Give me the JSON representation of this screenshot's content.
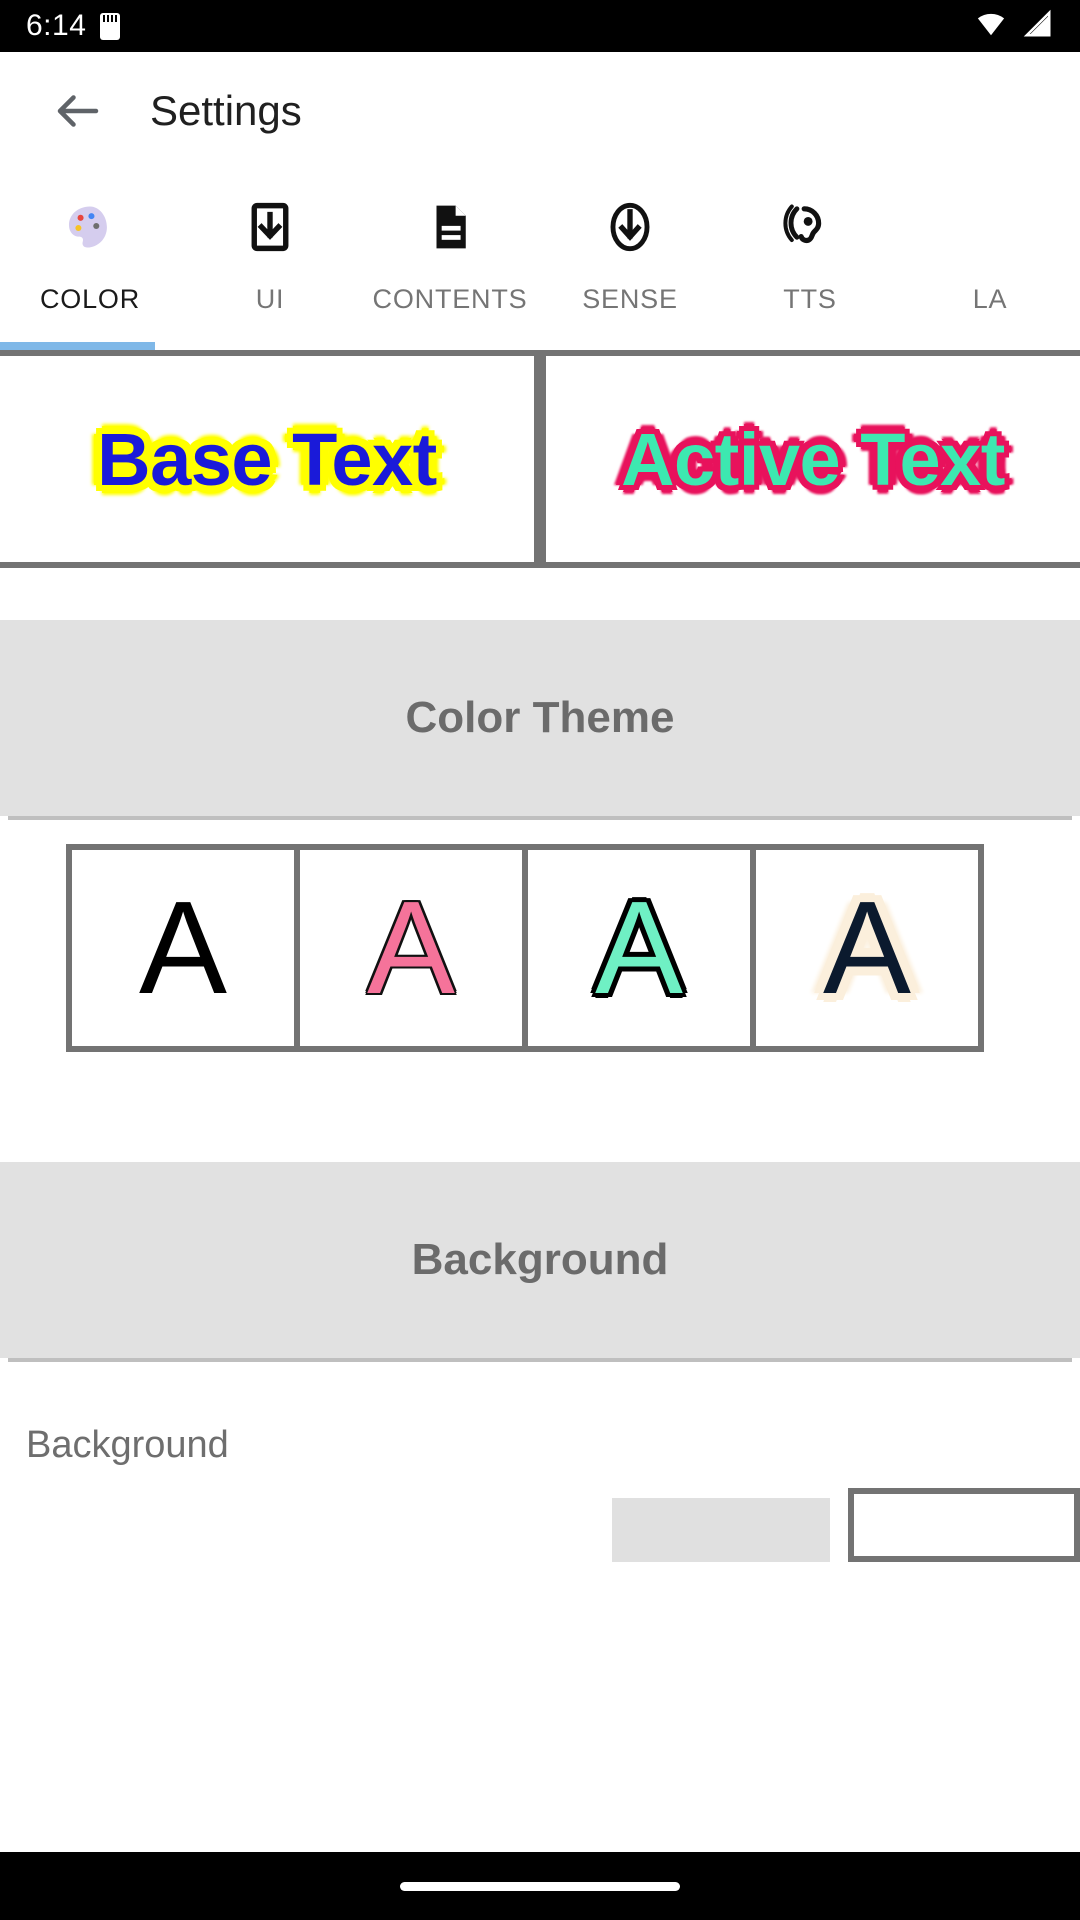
{
  "status_bar": {
    "time": "6:14",
    "sd_icon": "sd-card-icon",
    "wifi_icon": "wifi-icon",
    "signal_icon": "cell-signal-icon"
  },
  "app_bar": {
    "back_icon": "back-arrow-icon",
    "title": "Settings"
  },
  "tabs": [
    {
      "label": "COLOR",
      "icon": "palette-icon",
      "active": true
    },
    {
      "label": "UI",
      "icon": "download-box-icon",
      "active": false
    },
    {
      "label": "CONTENTS",
      "icon": "document-icon",
      "active": false
    },
    {
      "label": "SENSE",
      "icon": "circle-down-arrow-icon",
      "active": false
    },
    {
      "label": "TTS",
      "icon": "ear-hearing-icon",
      "active": false
    },
    {
      "label": "LA",
      "icon": "language-icon",
      "active": false
    }
  ],
  "preview": {
    "base": {
      "text": "Base Text",
      "text_color": "#1A1AD9",
      "outline_color": "#FFFF00",
      "background": "#FFFFFF"
    },
    "active": {
      "text": "Active Text",
      "text_color": "#3DE8B0",
      "outline_color": "#E8125C",
      "background": "#FFFFFF"
    }
  },
  "sections": {
    "color_theme": {
      "title": "Color Theme"
    },
    "background": {
      "title": "Background"
    }
  },
  "color_theme_swatches": [
    {
      "letter": "A",
      "name": "theme-default",
      "text_color": "#000000",
      "outline_color": "none",
      "background": "#FFFFFF"
    },
    {
      "letter": "A",
      "name": "theme-pink",
      "text_color": "#F5739A",
      "outline_color": "#111111",
      "background": "#FFFFFF"
    },
    {
      "letter": "A",
      "name": "theme-mint",
      "text_color": "#6FF0C4",
      "outline_color": "#000000",
      "background": "#FFFFFF"
    },
    {
      "letter": "A",
      "name": "theme-navy",
      "text_color": "#0B1A2E",
      "outline_color": "#FBEFDC",
      "background": "#FFFFFF"
    }
  ],
  "background_setting": {
    "label": "Background",
    "chip_color": "#E0E0E0",
    "preview_border": "#737373"
  },
  "nav_bar": {
    "handle": "gesture-home-handle"
  },
  "theme_colors": {
    "accent": "#7FB8E8",
    "section_bg": "#E1E1E1",
    "border_gray": "#737373",
    "muted_text": "#6B6B6B"
  }
}
